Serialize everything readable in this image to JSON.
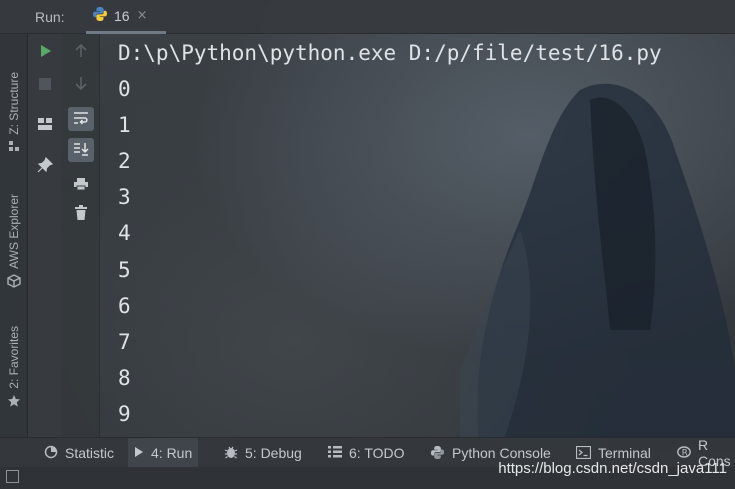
{
  "header": {
    "run_label": "Run:",
    "tab_title": "16",
    "tab_close": "×"
  },
  "left_strip": {
    "tabs": [
      {
        "label": "Z: Structure",
        "icon": "structure-icon"
      },
      {
        "label": "AWS Explorer",
        "icon": "aws-cube-icon"
      },
      {
        "label": "2: Favorites",
        "icon": "star-icon"
      }
    ]
  },
  "toolbar": {
    "buttons": [
      "run-icon",
      "stop-icon",
      "layout-icon",
      "pin-icon",
      "up-arrow-icon",
      "down-arrow-icon",
      "soft-wrap-icon",
      "scroll-to-end-icon",
      "print-icon",
      "trash-icon"
    ]
  },
  "console": {
    "command": "D:\\p\\Python\\python.exe D:/p/file/test/16.py",
    "lines": [
      "0",
      "1",
      "2",
      "3",
      "4",
      "5",
      "6",
      "7",
      "8",
      "9"
    ]
  },
  "bottom_tabs": [
    {
      "label": "Statistic",
      "icon": "statistic-icon"
    },
    {
      "label": "4: Run",
      "icon": "run-play-icon",
      "active": true
    },
    {
      "label": "5: Debug",
      "icon": "bug-icon"
    },
    {
      "label": "6: TODO",
      "icon": "todo-list-icon"
    },
    {
      "label": "Python Console",
      "icon": "python-icon"
    },
    {
      "label": "Terminal",
      "icon": "terminal-icon"
    },
    {
      "label": "R Cons",
      "icon": "r-console-icon"
    }
  ],
  "watermark": "https://blog.csdn.net/csdn_java111",
  "colors": {
    "run_green": "#59a869",
    "pressed_button": "#59616a",
    "text_primary": "#dfe3e6"
  }
}
